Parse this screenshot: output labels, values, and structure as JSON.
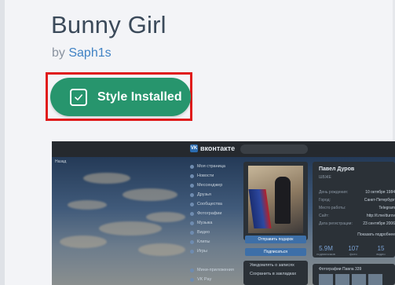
{
  "style": {
    "title": "Bunny Girl",
    "by_prefix": "by",
    "author": "Saph1s",
    "install_button_label": "Style Installed"
  },
  "colors": {
    "install_button": "#27956d",
    "highlight_border": "#e01b1b",
    "author_link": "#3f82c4",
    "title_text": "#3b4a5a"
  },
  "preview": {
    "site_name": "вконтакте",
    "back_link": "Назад",
    "menu_items": [
      "Моя страница",
      "Новости",
      "Мессенджер",
      "Друзья",
      "Сообщества",
      "Фотографии",
      "Музыка",
      "Видео",
      "Клипы",
      "Игры",
      "",
      "Мини-приложения",
      "VK Pay"
    ],
    "profile_name": "Павел Дуров",
    "profile_status": "ШБЖЕ",
    "info_rows": [
      {
        "label": "День рождения:",
        "value": "10 октября 1984"
      },
      {
        "label": "Город:",
        "value": "Санкт-Петербург"
      },
      {
        "label": "Место работы:",
        "value": "Telegram"
      },
      {
        "label": "Сайт:",
        "value": "http://t.me/durov"
      },
      {
        "label": "Дата регистрации:",
        "value": "23 сентября 2006"
      }
    ],
    "show_more": "Показать подробнее",
    "buttons": [
      "Отправить подарок",
      "Подписаться"
    ],
    "list_items": [
      "Уведомлять о записях",
      "Сохранить в закладках"
    ],
    "stats": [
      {
        "value": "5.9M",
        "label": "подписчиков"
      },
      {
        "value": "107",
        "label": "фото"
      },
      {
        "value": "15",
        "label": "видео"
      }
    ],
    "photos_heading": "Фотографии Павла",
    "photos_count": "339"
  }
}
